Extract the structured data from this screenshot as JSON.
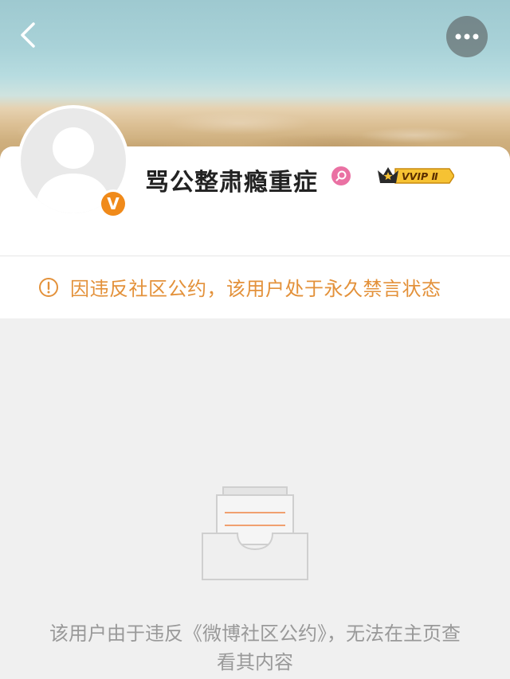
{
  "header": {
    "back_icon": "chevron-left-icon",
    "more_icon": "ellipsis-icon"
  },
  "profile": {
    "username": "骂公整肃瘾重症",
    "verified_badge": "V",
    "vip_badge": "VVIP Ⅱ",
    "accent_color": "#f08a1a"
  },
  "notice": {
    "icon": "exclamation-circle-icon",
    "text": "因违反社区公约，该用户处于永久禁言状态",
    "color": "#e3913a"
  },
  "empty_state": {
    "icon": "empty-inbox-icon",
    "message": "该用户由于违反《微博社区公约》，无法在主页查看其内容"
  }
}
